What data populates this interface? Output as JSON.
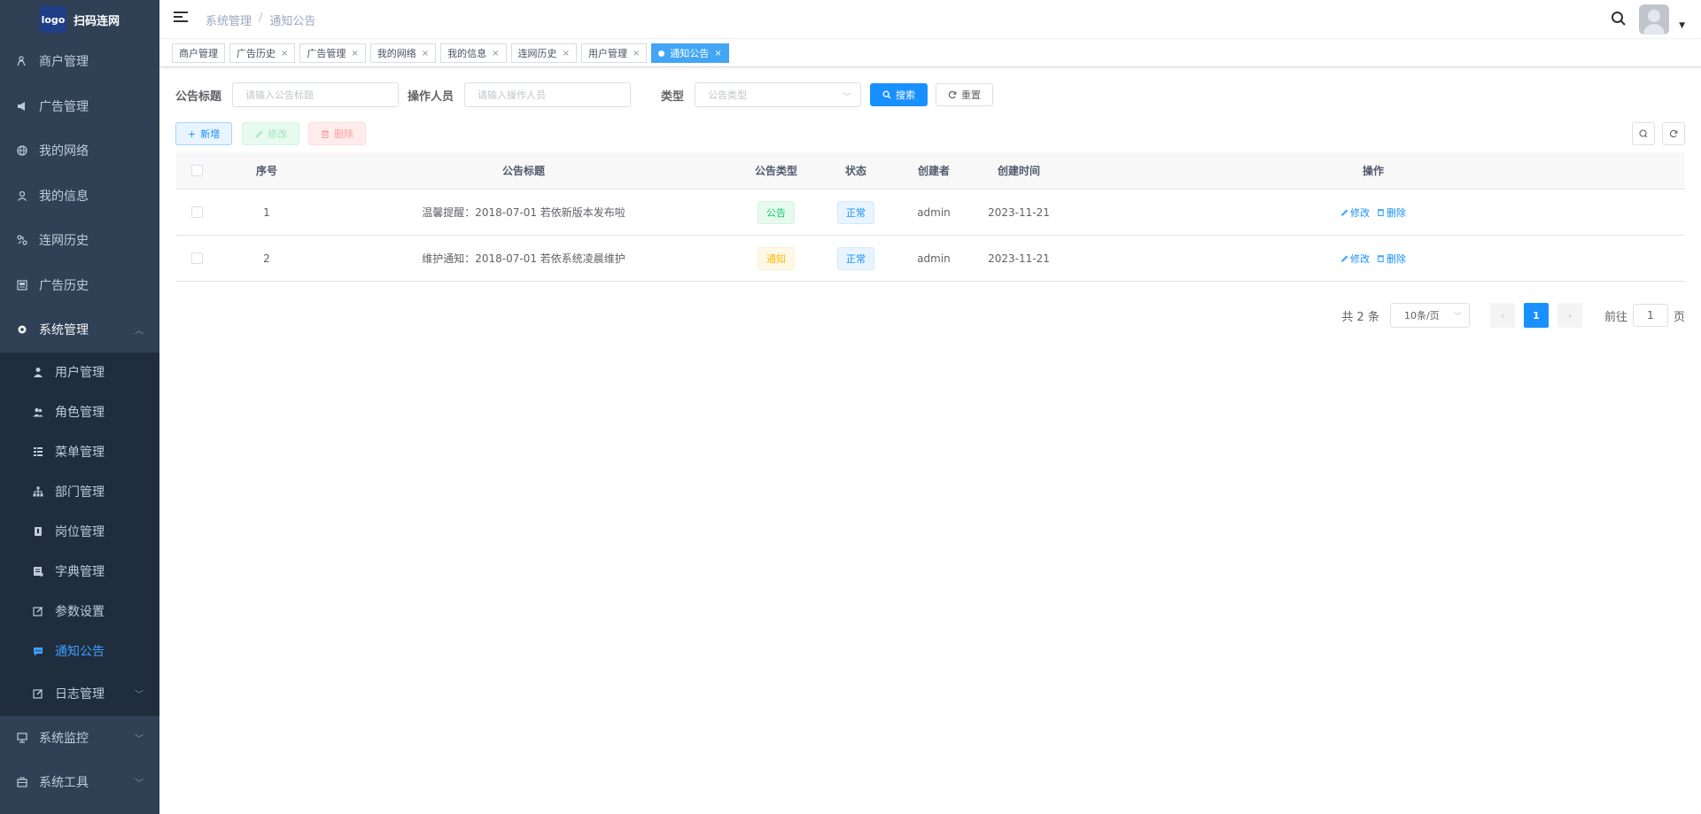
{
  "app": {
    "logo_text": "logo",
    "title": "扫码连网"
  },
  "sidebar": {
    "items": [
      {
        "label": "商户管理",
        "icon": "merchant-icon"
      },
      {
        "label": "广告管理",
        "icon": "megaphone-icon"
      },
      {
        "label": "我的网络",
        "icon": "globe-icon"
      },
      {
        "label": "我的信息",
        "icon": "user-icon"
      },
      {
        "label": "连网历史",
        "icon": "link-icon"
      },
      {
        "label": "广告历史",
        "icon": "picture-icon"
      },
      {
        "label": "系统管理",
        "icon": "gear-icon"
      }
    ],
    "sub_items": [
      {
        "label": "用户管理",
        "icon": "person-icon"
      },
      {
        "label": "角色管理",
        "icon": "people-icon"
      },
      {
        "label": "菜单管理",
        "icon": "tree-table-icon"
      },
      {
        "label": "部门管理",
        "icon": "hierarchy-icon"
      },
      {
        "label": "岗位管理",
        "icon": "post-icon"
      },
      {
        "label": "字典管理",
        "icon": "dict-icon"
      },
      {
        "label": "参数设置",
        "icon": "edit-icon"
      },
      {
        "label": "通知公告",
        "icon": "message-icon"
      },
      {
        "label": "日志管理",
        "icon": "log-icon"
      }
    ],
    "bottom_items": [
      {
        "label": "系统监控",
        "icon": "monitor-icon"
      },
      {
        "label": "系统工具",
        "icon": "toolbox-icon"
      }
    ]
  },
  "breadcrumb": {
    "parent": "系统管理",
    "separator": "/",
    "current": "通知公告"
  },
  "tags": [
    {
      "label": "商户管理",
      "closable": false
    },
    {
      "label": "广告历史",
      "closable": true
    },
    {
      "label": "广告管理",
      "closable": true
    },
    {
      "label": "我的网络",
      "closable": true
    },
    {
      "label": "我的信息",
      "closable": true
    },
    {
      "label": "连网历史",
      "closable": true
    },
    {
      "label": "用户管理",
      "closable": true
    },
    {
      "label": "通知公告",
      "closable": true,
      "active": true
    }
  ],
  "close_glyph": "×",
  "search_form": {
    "title_label": "公告标题",
    "title_placeholder": "请输入公告标题",
    "operator_label": "操作人员",
    "operator_placeholder": "请输入操作人员",
    "type_label": "类型",
    "type_placeholder": "公告类型",
    "search_button": "搜索",
    "reset_button": "重置"
  },
  "toolbar": {
    "add_label": "新增",
    "edit_label": "修改",
    "delete_label": "删除"
  },
  "table": {
    "headers": [
      "序号",
      "公告标题",
      "公告类型",
      "状态",
      "创建者",
      "创建时间",
      "操作"
    ],
    "rows": [
      {
        "no": "1",
        "title": "温馨提醒：2018-07-01 若依新版本发布啦",
        "type": "公告",
        "status": "正常",
        "creator": "admin",
        "time": "2023-11-21",
        "edit": "修改",
        "delete": "删除"
      },
      {
        "no": "2",
        "title": "维护通知：2018-07-01 若依系统凌晨维护",
        "type": "通知",
        "status": "正常",
        "creator": "admin",
        "time": "2023-11-21",
        "edit": "修改",
        "delete": "删除"
      }
    ]
  },
  "pagination": {
    "total": "共 2 条",
    "page_size": "10条/页",
    "current_page": "1",
    "goto_label": "前往",
    "goto_value": "1",
    "page_unit": "页"
  },
  "colors": {
    "sidebar_bg": "#304156",
    "submenu_bg": "#1f2d3d",
    "accent": "#1890ff",
    "active_tag": "#42a5f5"
  }
}
